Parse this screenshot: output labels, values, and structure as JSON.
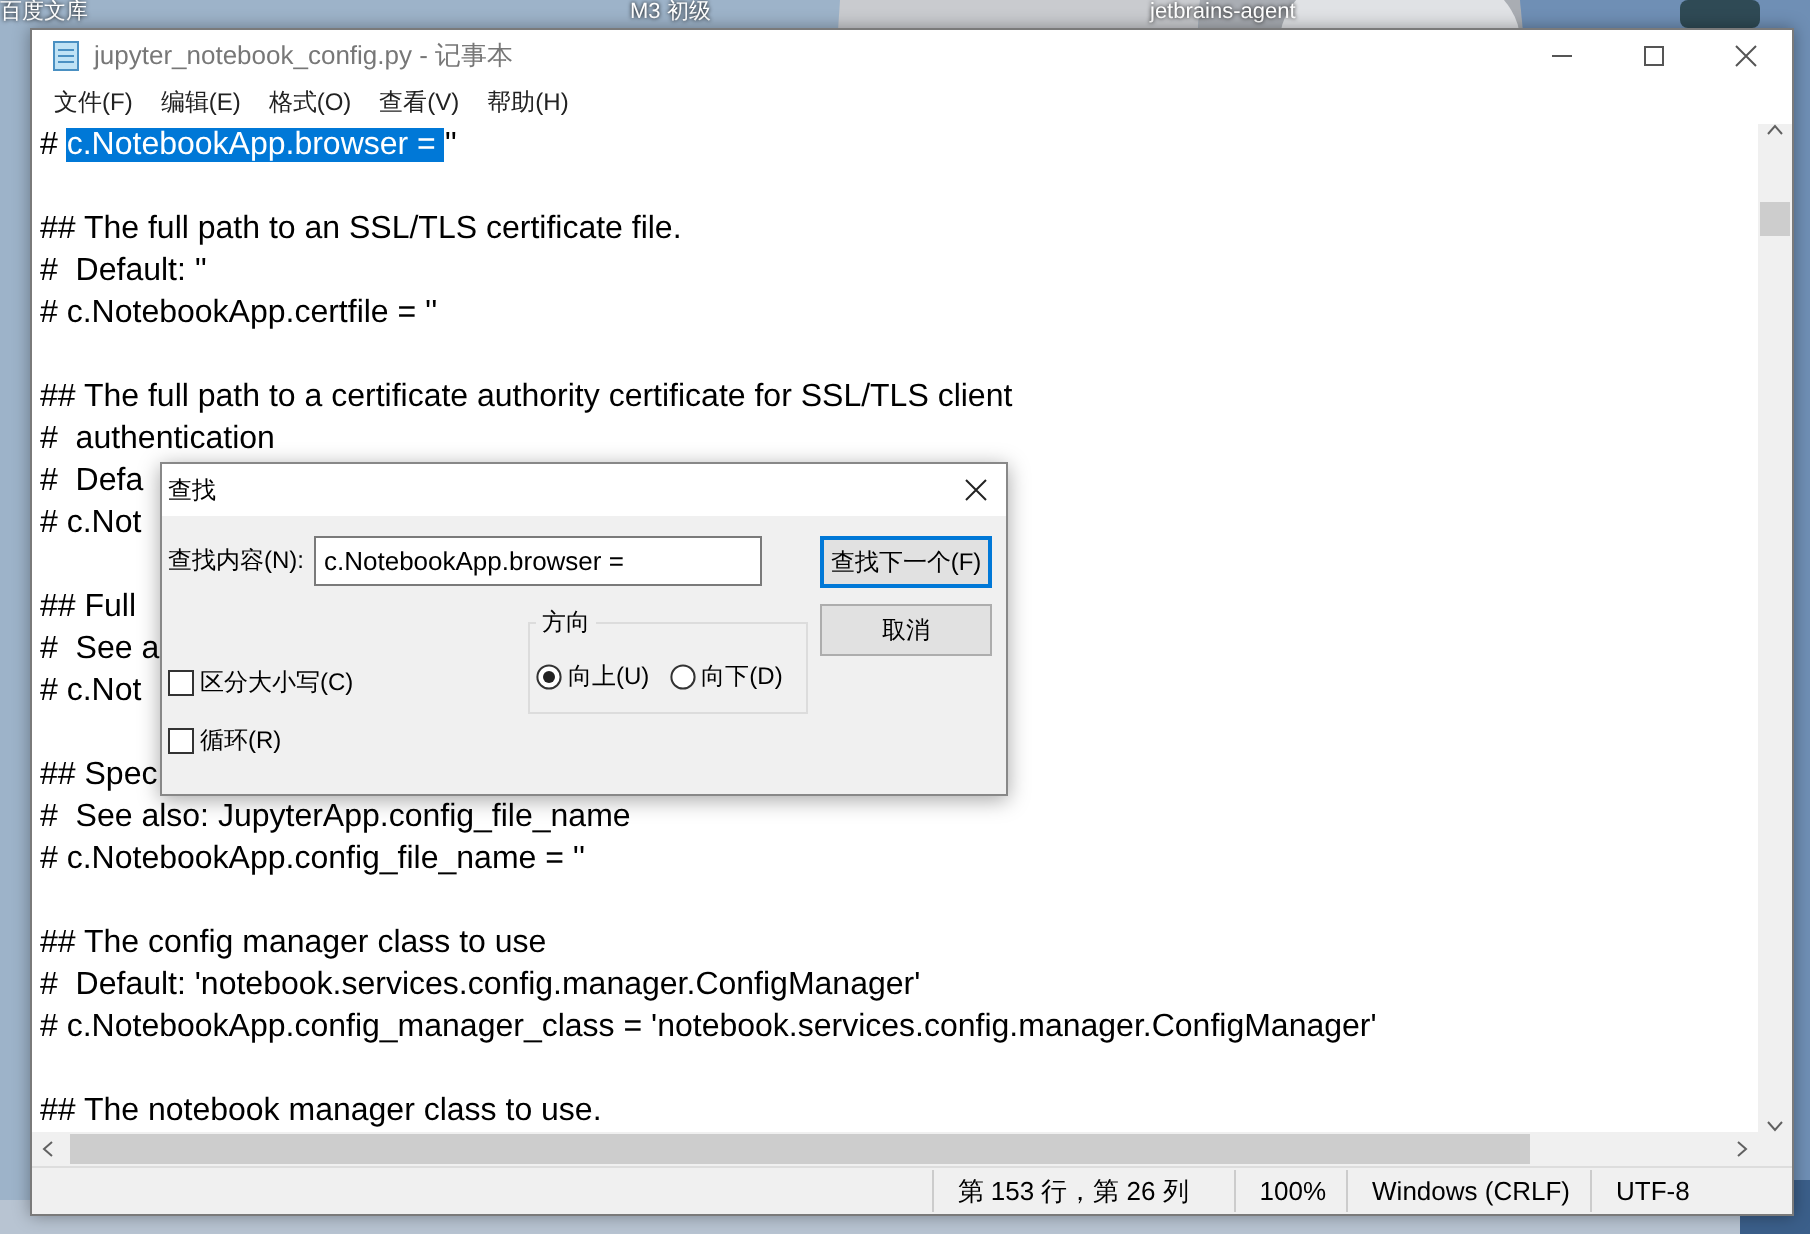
{
  "desktop": {
    "icon_labels": [
      "百度文库",
      "M3 初级",
      "jetbrains-agent"
    ]
  },
  "window": {
    "title": "jupyter_notebook_config.py - 记事本"
  },
  "menu": [
    "文件(F)",
    "编辑(E)",
    "格式(O)",
    "查看(V)",
    "帮助(H)"
  ],
  "editor": {
    "lines": [
      {
        "kind": "selection",
        "segments": [
          {
            "text": "# ",
            "selected": false
          },
          {
            "text": "c.NotebookApp.browser = ",
            "selected": true
          },
          {
            "text": "''",
            "selected": false
          }
        ]
      },
      {
        "kind": "blank"
      },
      {
        "kind": "text",
        "text": "## The full path to an SSL/TLS certificate file."
      },
      {
        "kind": "text",
        "text": "#  Default: ''"
      },
      {
        "kind": "text",
        "text": "# c.NotebookApp.certfile = ''"
      },
      {
        "kind": "blank"
      },
      {
        "kind": "text",
        "text": "## The full path to a certificate authority certificate for SSL/TLS client"
      },
      {
        "kind": "text",
        "text": "#  authentication"
      },
      {
        "kind": "text",
        "text": "#  Defa"
      },
      {
        "kind": "text",
        "text": "# c.Not"
      },
      {
        "kind": "blank"
      },
      {
        "kind": "text",
        "text": "## Full"
      },
      {
        "kind": "text",
        "text": "#  See a"
      },
      {
        "kind": "text",
        "text": "# c.Not"
      },
      {
        "kind": "blank"
      },
      {
        "kind": "text",
        "text": "## Spec"
      },
      {
        "kind": "text",
        "text": "#  See also: JupyterApp.config_file_name"
      },
      {
        "kind": "text",
        "text": "# c.NotebookApp.config_file_name = ''"
      },
      {
        "kind": "blank"
      },
      {
        "kind": "text",
        "text": "## The config manager class to use"
      },
      {
        "kind": "text",
        "text": "#  Default: 'notebook.services.config.manager.ConfigManager'"
      },
      {
        "kind": "text",
        "text": "# c.NotebookApp.config_manager_class = 'notebook.services.config.manager.ConfigManager'"
      },
      {
        "kind": "blank"
      },
      {
        "kind": "text",
        "text": "## The notebook manager class to use."
      }
    ]
  },
  "status_bar": [
    "第 153 行，第 26 列",
    "100%",
    "Windows (CRLF)",
    "UTF-8"
  ],
  "find_dialog": {
    "title": "查找",
    "find_label": "查找内容(N):",
    "find_value": "c.NotebookApp.browser =",
    "buttons": [
      {
        "label": "查找下一个(F)",
        "focused": true
      },
      {
        "label": "取消",
        "focused": false
      }
    ],
    "direction": {
      "title": "方向",
      "options": [
        {
          "label": "向上(U)",
          "selected": true
        },
        {
          "label": "向下(D)",
          "selected": false
        }
      ]
    },
    "checkboxes": [
      {
        "label": "区分大小写(C)",
        "checked": false
      },
      {
        "label": "循环(R)",
        "checked": false
      }
    ]
  }
}
